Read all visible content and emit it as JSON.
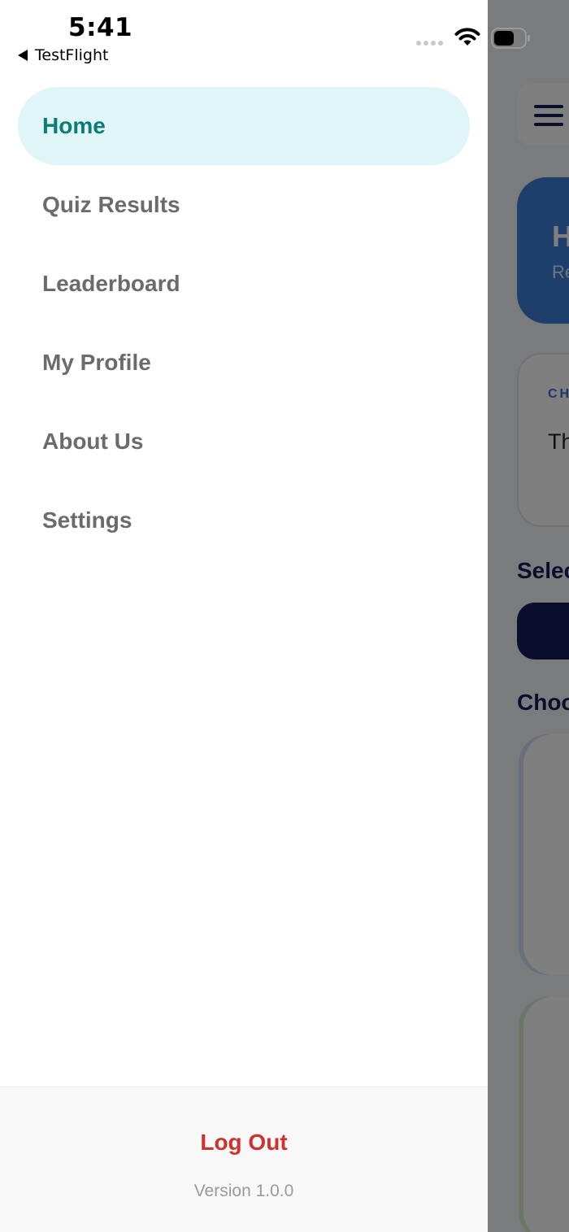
{
  "status_bar": {
    "time": "5:41",
    "back_app": "TestFlight",
    "icons": [
      "cellular-signal-icon",
      "wifi-icon",
      "battery-icon"
    ]
  },
  "drawer": {
    "menu": [
      {
        "label": "Home",
        "active": true
      },
      {
        "label": "Quiz Results",
        "active": false
      },
      {
        "label": "Leaderboard",
        "active": false
      },
      {
        "label": "My Profile",
        "active": false
      },
      {
        "label": "About Us",
        "active": false
      },
      {
        "label": "Settings",
        "active": false
      }
    ],
    "logout_label": "Log Out",
    "version_label": "Version 1.0.0"
  },
  "background_app": {
    "hero_title_partial": "H",
    "hero_subtitle_partial": "Re",
    "card_tag_partial": "CH",
    "card_text_partial": "Th",
    "select_heading_partial": "Selec",
    "choose_heading_partial": "Choo"
  },
  "colors": {
    "active_item_bg": "#dff5f7",
    "active_item_text": "#0c7c75",
    "inactive_item_text": "#6b6b6b",
    "logout_text": "#d0312d",
    "version_text": "#9a9a9a",
    "overlay": "rgba(0,0,0,0.5)",
    "accent_navy": "#151b58",
    "accent_blue": "#3d7ed9"
  }
}
